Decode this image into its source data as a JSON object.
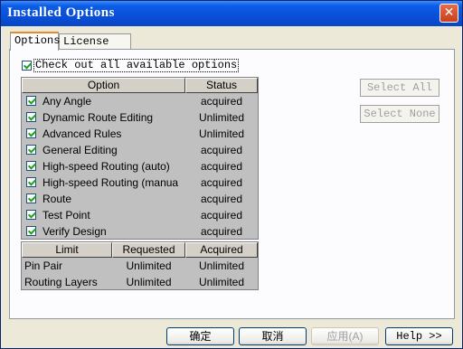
{
  "window": {
    "title": "Installed Options",
    "close_glyph": "✕"
  },
  "tabs": [
    {
      "label": "Options",
      "active": true
    },
    {
      "label": "License File",
      "active": false
    }
  ],
  "check_all": {
    "label": "Check out all available options",
    "checked": true
  },
  "options_table": {
    "headers": {
      "option": "Option",
      "status": "Status"
    },
    "rows": [
      {
        "option": "Any Angle",
        "status": "acquired",
        "checked": true
      },
      {
        "option": "Dynamic Route Editing",
        "status": "Unlimited",
        "checked": true
      },
      {
        "option": "Advanced Rules",
        "status": "Unlimited",
        "checked": true
      },
      {
        "option": "General Editing",
        "status": "acquired",
        "checked": true
      },
      {
        "option": "High-speed Routing (auto)",
        "status": "acquired",
        "checked": true
      },
      {
        "option": "High-speed Routing (manua",
        "status": "acquired",
        "checked": true
      },
      {
        "option": "Route",
        "status": "acquired",
        "checked": true
      },
      {
        "option": "Test Point",
        "status": "acquired",
        "checked": true
      },
      {
        "option": "Verify Design",
        "status": "acquired",
        "checked": true
      }
    ]
  },
  "limits_table": {
    "headers": {
      "limit": "Limit",
      "requested": "Requested",
      "acquired": "Acquired"
    },
    "rows": [
      {
        "limit": "Pin Pair",
        "requested": "Unlimited",
        "acquired": "Unlimited"
      },
      {
        "limit": "Routing Layers",
        "requested": "Unlimited",
        "acquired": "Unlimited"
      }
    ]
  },
  "side_buttons": {
    "select_all": "Select All",
    "select_none": "Select None"
  },
  "footer_buttons": {
    "ok": "确定",
    "cancel": "取消",
    "apply": "应用(A)",
    "help": "Help >>"
  }
}
